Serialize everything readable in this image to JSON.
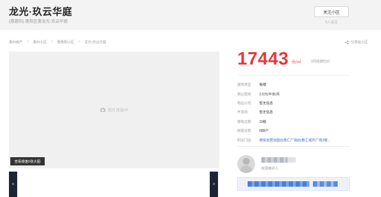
{
  "header": {
    "title": "龙光·玖云华庭",
    "subtitle": "(惠惠阳) 惠阳区惠龙光·玖云华庭",
    "follow_label": "关注小区",
    "follow_count": "5人关注"
  },
  "breadcrumb": {
    "items": [
      "惠州房产",
      "惠州小区",
      "惠惠阳小区",
      "龙光·玖云华庭"
    ],
    "separator": ">"
  },
  "share": {
    "label": "分享给小区"
  },
  "gallery": {
    "placeholder": "图片准备中",
    "view_all_label": "查看楼盘0张大图",
    "prev_label": "<",
    "next_label": ">"
  },
  "price": {
    "value": "17443",
    "unit": "元/㎡",
    "month_label": "3月挂牌均价"
  },
  "info": [
    {
      "label": "建筑类型",
      "value": "板楼",
      "link": false
    },
    {
      "label": "物业费用",
      "value": "2.5元/平米/月",
      "link": false
    },
    {
      "label": "物业公司",
      "value": "暂无信息",
      "link": false
    },
    {
      "label": "开发商",
      "value": "暂无信息",
      "link": false
    },
    {
      "label": "楼栋总数",
      "value": "10栋",
      "link": false
    },
    {
      "label": "房屋总数",
      "value": "688户",
      "link": false
    },
    {
      "label": "附近门店",
      "value": "德佑安居加盟店惠汇广场店/惠汇城市广场2楼...",
      "link": true
    }
  ],
  "agent": {
    "role": "房源维护人"
  },
  "colors": {
    "price": "#e4393c",
    "link": "#3a6fb8",
    "nav_dark": "#1d2434",
    "header_bg": "#f3f3f3"
  },
  "icons": {
    "camera": "camera-icon",
    "share": "share-icon"
  }
}
